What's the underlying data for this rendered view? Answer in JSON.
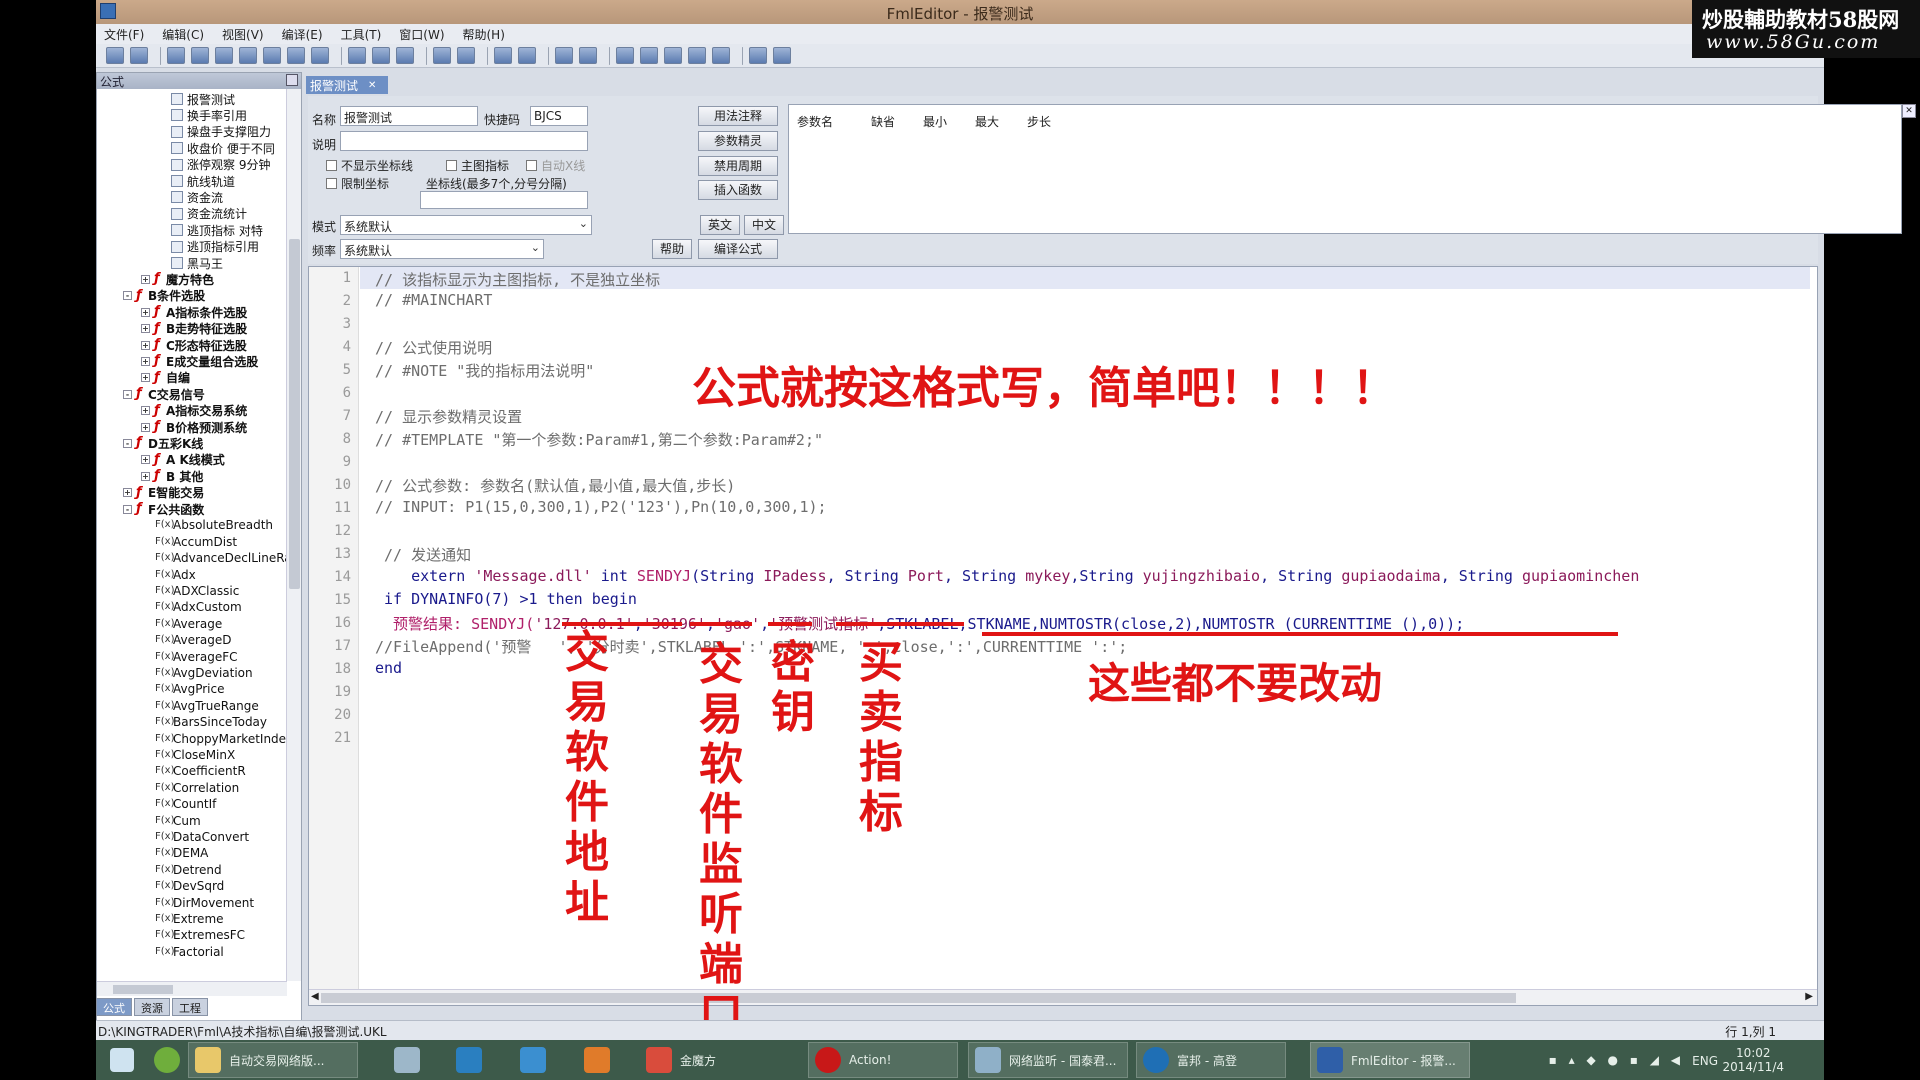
{
  "window": {
    "title": "FmlEditor - 报警测试"
  },
  "watermark": {
    "line1": "炒股輔助教材58股网",
    "line2": "www.58Gu.com"
  },
  "menu": [
    "文件(F)",
    "编辑(C)",
    "视图(V)",
    "编译(E)",
    "工具(T)",
    "窗口(W)",
    "帮助(H)"
  ],
  "left_panel": {
    "title": "公式",
    "tree": [
      {
        "label": "报警测试",
        "depth": 4,
        "kind": "doc"
      },
      {
        "label": "换手率引用",
        "depth": 4,
        "kind": "doc"
      },
      {
        "label": "操盘手支撑阻力",
        "depth": 4,
        "kind": "doc"
      },
      {
        "label": "收盘价 便于不同",
        "depth": 4,
        "kind": "doc"
      },
      {
        "label": "涨停观察 9分钟",
        "depth": 4,
        "kind": "doc"
      },
      {
        "label": "航线轨道",
        "depth": 4,
        "kind": "doc"
      },
      {
        "label": "资金流",
        "depth": 4,
        "kind": "doc"
      },
      {
        "label": "资金流统计",
        "depth": 4,
        "kind": "doc"
      },
      {
        "label": "逃顶指标 对特",
        "depth": 4,
        "kind": "doc"
      },
      {
        "label": "逃顶指标引用",
        "depth": 4,
        "kind": "doc"
      },
      {
        "label": "黑马王",
        "depth": 4,
        "kind": "doc"
      },
      {
        "label": "魔方特色",
        "depth": 2,
        "kind": "folder",
        "exp": "+"
      },
      {
        "label": "B条件选股",
        "depth": 1,
        "kind": "folder",
        "exp": "-"
      },
      {
        "label": "A指标条件选股",
        "depth": 2,
        "kind": "folder",
        "exp": "+"
      },
      {
        "label": "B走势特征选股",
        "depth": 2,
        "kind": "folder",
        "exp": "+"
      },
      {
        "label": "C形态特征选股",
        "depth": 2,
        "kind": "folder",
        "exp": "+"
      },
      {
        "label": "E成交量组合选股",
        "depth": 2,
        "kind": "folder",
        "exp": "+"
      },
      {
        "label": "自编",
        "depth": 2,
        "kind": "folder",
        "exp": "+"
      },
      {
        "label": "C交易信号",
        "depth": 1,
        "kind": "folder",
        "exp": "-"
      },
      {
        "label": "A指标交易系统",
        "depth": 2,
        "kind": "folder",
        "exp": "+"
      },
      {
        "label": "B价格预测系统",
        "depth": 2,
        "kind": "folder",
        "exp": "+"
      },
      {
        "label": "D五彩K线",
        "depth": 1,
        "kind": "folder",
        "exp": "-"
      },
      {
        "label": "A K线模式",
        "depth": 2,
        "kind": "folder",
        "exp": "+"
      },
      {
        "label": "B 其他",
        "depth": 2,
        "kind": "folder",
        "exp": "+"
      },
      {
        "label": "E智能交易",
        "depth": 1,
        "kind": "folder",
        "exp": "+"
      },
      {
        "label": "F公共函数",
        "depth": 1,
        "kind": "folder",
        "exp": "-"
      },
      {
        "label": "AbsoluteBreadth",
        "depth": 3,
        "kind": "fx"
      },
      {
        "label": "AccumDist",
        "depth": 3,
        "kind": "fx"
      },
      {
        "label": "AdvanceDeclLineRat",
        "depth": 3,
        "kind": "fx"
      },
      {
        "label": "Adx",
        "depth": 3,
        "kind": "fx"
      },
      {
        "label": "ADXClassic",
        "depth": 3,
        "kind": "fx"
      },
      {
        "label": "AdxCustom",
        "depth": 3,
        "kind": "fx"
      },
      {
        "label": "Average",
        "depth": 3,
        "kind": "fx"
      },
      {
        "label": "AverageD",
        "depth": 3,
        "kind": "fx"
      },
      {
        "label": "AverageFC",
        "depth": 3,
        "kind": "fx"
      },
      {
        "label": "AvgDeviation",
        "depth": 3,
        "kind": "fx"
      },
      {
        "label": "AvgPrice",
        "depth": 3,
        "kind": "fx"
      },
      {
        "label": "AvgTrueRange",
        "depth": 3,
        "kind": "fx"
      },
      {
        "label": "BarsSinceToday",
        "depth": 3,
        "kind": "fx"
      },
      {
        "label": "ChoppyMarketIndex",
        "depth": 3,
        "kind": "fx"
      },
      {
        "label": "CloseMinX",
        "depth": 3,
        "kind": "fx"
      },
      {
        "label": "CoefficientR",
        "depth": 3,
        "kind": "fx"
      },
      {
        "label": "Correlation",
        "depth": 3,
        "kind": "fx"
      },
      {
        "label": "CountIf",
        "depth": 3,
        "kind": "fx"
      },
      {
        "label": "Cum",
        "depth": 3,
        "kind": "fx"
      },
      {
        "label": "DataConvert",
        "depth": 3,
        "kind": "fx"
      },
      {
        "label": "DEMA",
        "depth": 3,
        "kind": "fx"
      },
      {
        "label": "Detrend",
        "depth": 3,
        "kind": "fx"
      },
      {
        "label": "DevSqrd",
        "depth": 3,
        "kind": "fx"
      },
      {
        "label": "DirMovement",
        "depth": 3,
        "kind": "fx"
      },
      {
        "label": "Extreme",
        "depth": 3,
        "kind": "fx"
      },
      {
        "label": "ExtremesFC",
        "depth": 3,
        "kind": "fx"
      },
      {
        "label": "Factorial",
        "depth": 3,
        "kind": "fx"
      }
    ],
    "fx_tag": "F(x)",
    "tabs": [
      "公式",
      "资源",
      "工程"
    ]
  },
  "doc_tab": {
    "label": "报警测试",
    "close": "✕"
  },
  "form": {
    "name_label": "名称",
    "name_value": "报警测试",
    "shortcut_label": "快捷码",
    "shortcut_value": "BJCS",
    "desc_label": "说明",
    "desc_value": "",
    "btn_usage": "用法注释",
    "btn_params": "参数精灵",
    "btn_disable_period": "禁用周期",
    "btn_insert_func": "插入函数",
    "chk_hide_axis": "不显示坐标线",
    "chk_main_chart": "主图指标",
    "chk_auto_x": "自动X线",
    "chk_limit_axis": "限制坐标",
    "axis_hint": "坐标线(最多7个,分号分隔)",
    "mode_label": "模式",
    "mode_value": "系统默认",
    "btn_english": "英文",
    "btn_chinese": "中文",
    "freq_label": "频率",
    "freq_value": "系统默认",
    "btn_help": "帮助",
    "btn_compile": "编译公式",
    "param_headers": [
      "参数名",
      "缺省",
      "最小",
      "最大",
      "步长"
    ]
  },
  "editor": {
    "line_numbers": [
      "1",
      "2",
      "3",
      "4",
      "5",
      "6",
      "7",
      "8",
      "9",
      "10",
      "11",
      "12",
      "13",
      "14",
      "15",
      "16",
      "17",
      "18",
      "19",
      "20",
      "21"
    ],
    "lines": {
      "l1": "// 该指标显示为主图指标, 不是独立坐标",
      "l2": "// #MAINCHART",
      "l4": "// 公式使用说明",
      "l5": "// #NOTE \"我的指标用法说明\"",
      "l7": "// 显示参数精灵设置",
      "l8": "// #TEMPLATE \"第一个参数:Param#1,第二个参数:Param#2;\"",
      "l10": "// 公式参数: 参数名(默认值,最小值,最大值,步长)",
      "l11": "// INPUT: P1(15,0,300,1),P2('123'),Pn(10,0,300,1);",
      "l13": " // 发送通知",
      "l14_a": "    extern ",
      "l14_b": "'Message.dll'",
      "l14_c": " int ",
      "l14_d": "SENDYJ",
      "l14_e": "(String ",
      "l14_f": "IPadess",
      "l14_g": ", String ",
      "l14_h": "Port",
      "l14_i": ", String ",
      "l14_j": "mykey",
      "l14_k": ",String ",
      "l14_l": "yujingzhibaio",
      "l14_m": ", String ",
      "l14_n": "gupiaodaima",
      "l14_o": ", String ",
      "l14_p": "gupiaominchen",
      "l15": " if DYNAINFO(7) >1 then begin",
      "l16_a": "  预警结果: ",
      "l16_b": "SENDYJ(",
      "l16_c": "'127.0.0.1'",
      "l16_d": ",",
      "l16_e": "'30196'",
      "l16_f": ",",
      "l16_g": "'gao'",
      "l16_h": ",",
      "l16_i": "'预警测试指标'",
      "l16_j": ",STKLABEL,STKNAME,NUMTOSTR(close,2),NUMTOSTR (CURRENTTIME (),0));",
      "l17": "//FileAppend('预警   ', '分时卖',STKLABEL ':',STKNAME, ':',close,':',CURRENTTIME ':';",
      "l18": "end"
    }
  },
  "annotations": {
    "headline": "公式就按这格式写，简单吧！！！！",
    "no_change": "这些都不要改动",
    "address": "交易软件地址",
    "port": "交易软件监听端口",
    "key": "密钥",
    "indicator": "买卖指标"
  },
  "status": {
    "path": "D:\\KINGTRADER\\Fml\\A技术指标\\自编\\报警测试.UKL",
    "position": "行 1,列 1"
  },
  "taskbar": {
    "items": [
      "自动交易网络版...",
      "金魔方",
      "Action!",
      "网络监听 - 国泰君...",
      "富邦 - 高登",
      "FmlEditor - 报警..."
    ],
    "lang": "ENG",
    "time": "10:02",
    "date": "2014/11/4"
  },
  "colors": {
    "annotation": "#e01414",
    "comment": "#6d6d6d",
    "keyword": "#1a1a8c",
    "string": "#8b1a5a"
  }
}
